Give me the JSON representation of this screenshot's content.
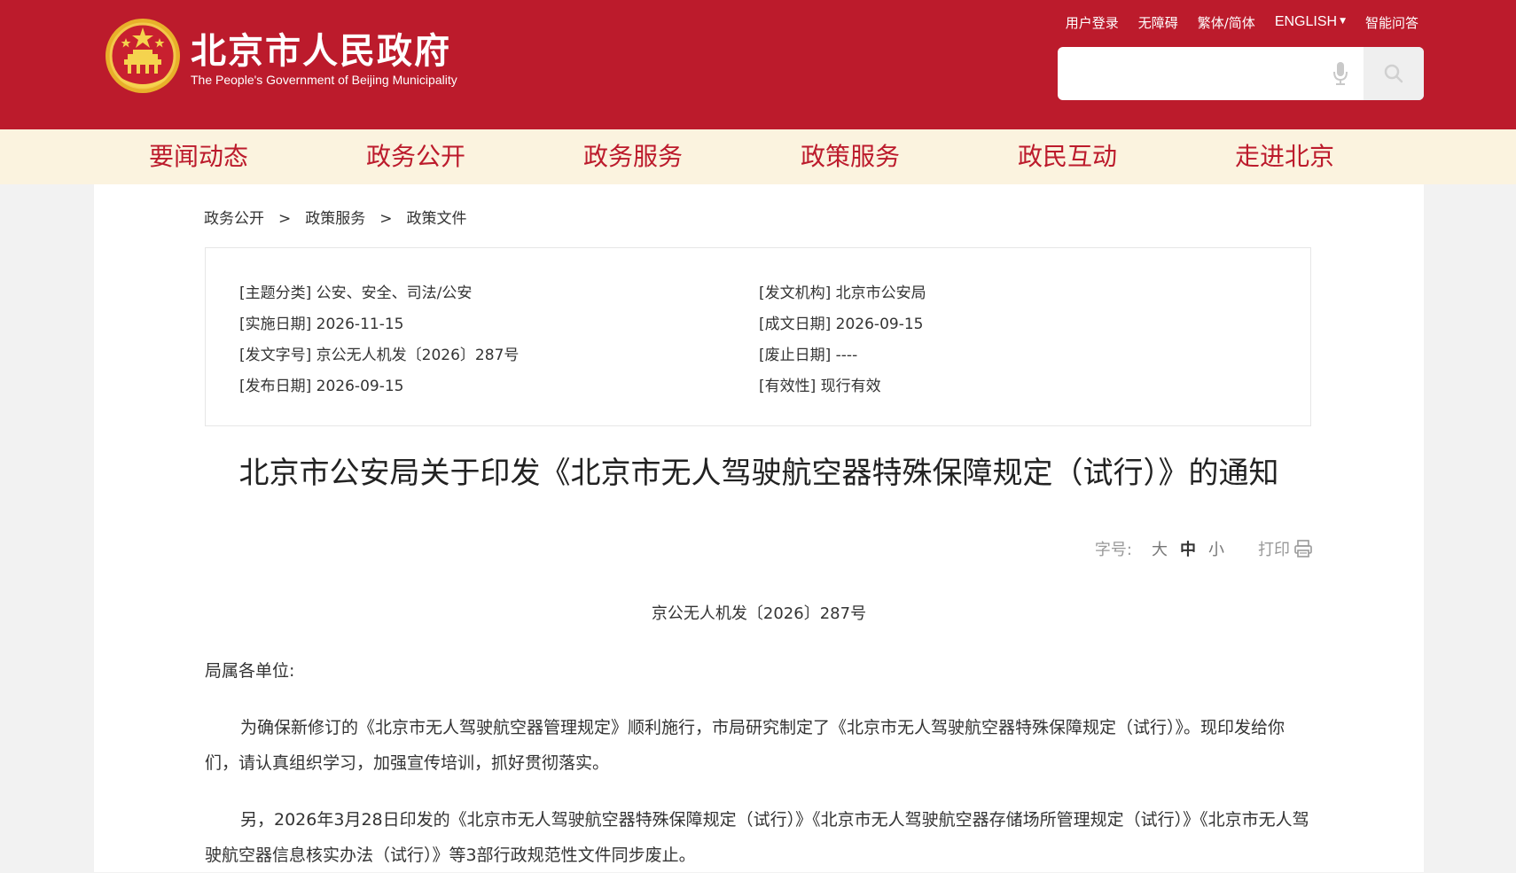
{
  "header": {
    "title": "北京市人民政府",
    "subtitle": "The People's Government of Beijing Municipality",
    "top_links": [
      "用户登录",
      "无障碍",
      "繁体/简体",
      "ENGLISH",
      "智能问答"
    ],
    "search": {
      "placeholder": ""
    },
    "colors": {
      "primary": "#bc1b2c",
      "nav_bg": "#fbf3df"
    }
  },
  "nav": {
    "items": [
      "要闻动态",
      "政务公开",
      "政务服务",
      "政策服务",
      "政民互动",
      "走进北京"
    ]
  },
  "breadcrumb": {
    "items": [
      "政务公开",
      "政策服务",
      "政策文件"
    ],
    "separator": ">"
  },
  "meta": {
    "left": [
      "[主题分类] 公安、安全、司法/公安",
      "[实施日期] 2026-11-15",
      "[发文字号] 京公无人机发〔2026〕287号",
      "[发布日期] 2026-09-15"
    ],
    "right": [
      "[发文机构] 北京市公安局",
      "[成文日期] 2026-09-15",
      "[废止日期] ----",
      "[有效性] 现行有效"
    ]
  },
  "document": {
    "title": "北京市公安局关于印发《北京市无人驾驶航空器特殊保障规定（试行）》的通知",
    "font_size_label": "字号:",
    "font_sizes": [
      "大",
      "中",
      "小"
    ],
    "print_label": "打印",
    "number": "京公无人机发〔2026〕287号",
    "salutation": "局属各单位:",
    "paragraphs": [
      "为确保新修订的《北京市无人驾驶航空器管理规定》顺利施行，市局研究制定了《北京市无人驾驶航空器特殊保障规定（试行）》。现印发给你们，请认真组织学习，加强宣传培训，抓好贯彻落实。",
      "另，2026年3月28日印发的《北京市无人驾驶航空器特殊保障规定（试行）》《北京市无人驾驶航空器存储场所管理规定（试行）》《北京市无人驾驶航空器信息核实办法（试行）》等3部行政规范性文件同步废止。"
    ]
  }
}
